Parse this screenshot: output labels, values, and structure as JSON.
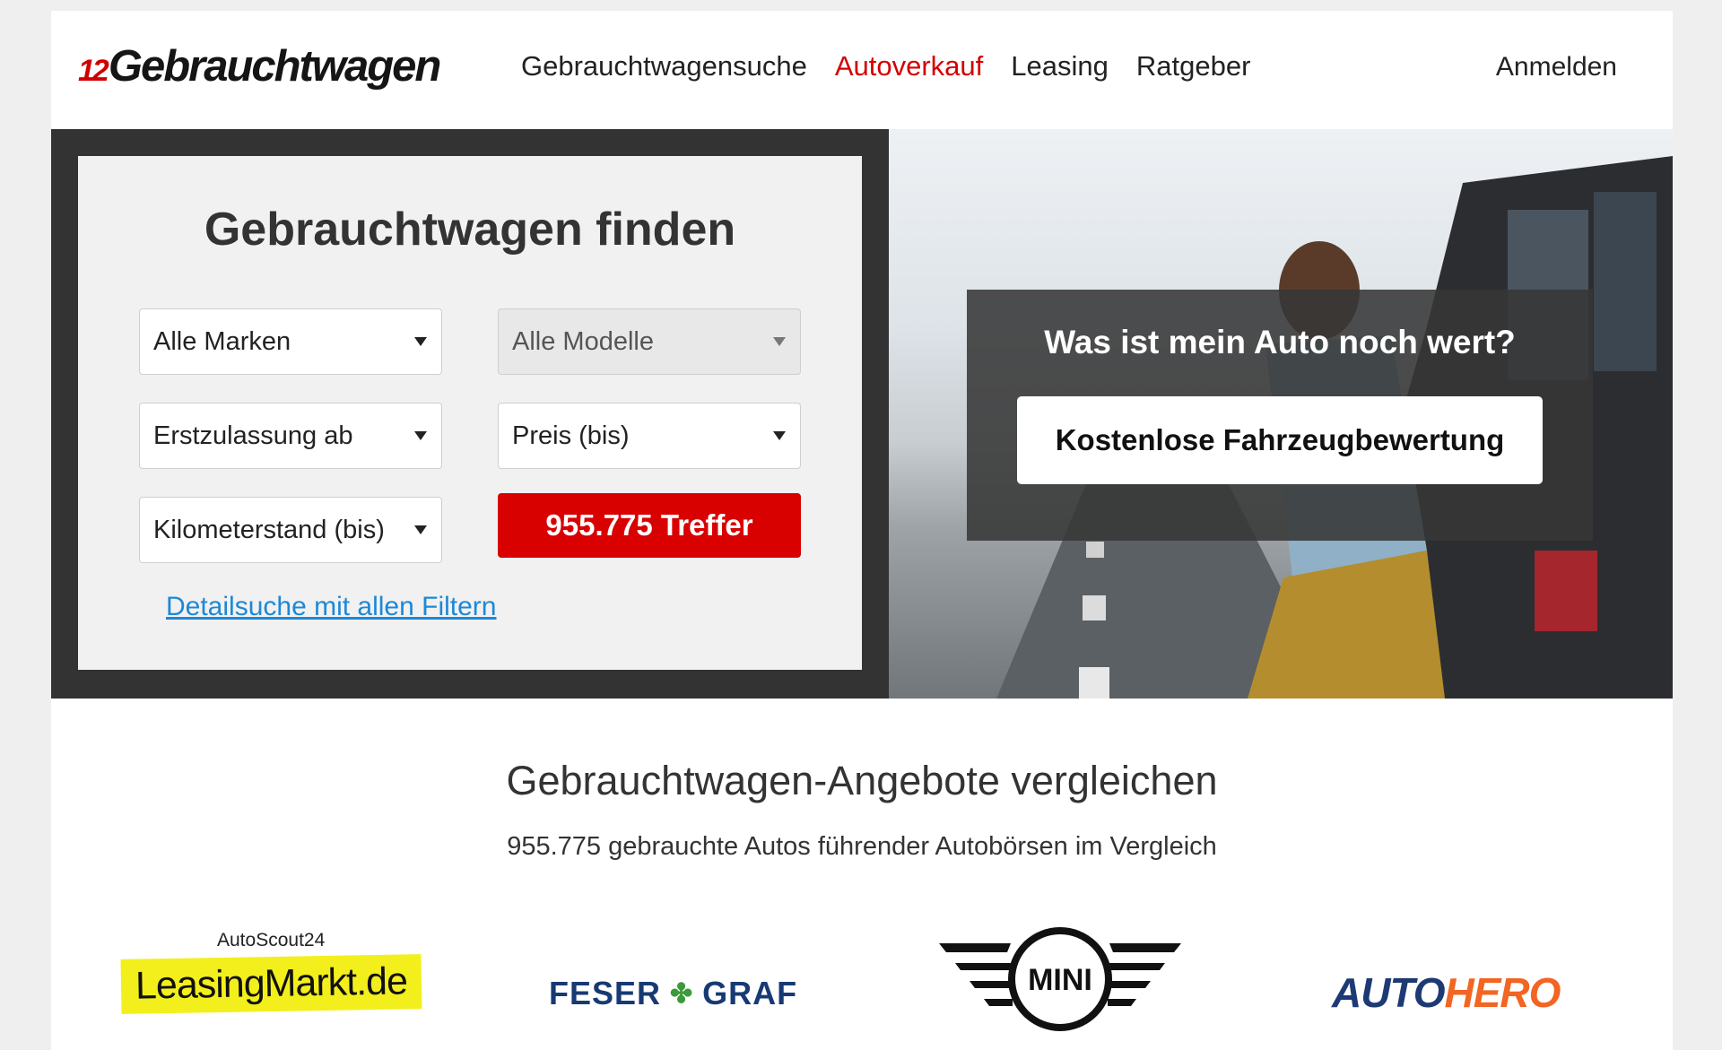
{
  "header": {
    "logo_number": "12",
    "logo_word": "Gebrauchtwagen",
    "nav": [
      {
        "label": "Gebrauchtwagensuche",
        "active": false
      },
      {
        "label": "Autoverkauf",
        "active": true
      },
      {
        "label": "Leasing",
        "active": false
      },
      {
        "label": "Ratgeber",
        "active": false
      }
    ],
    "login_label": "Anmelden"
  },
  "search": {
    "title": "Gebrauchtwagen finden",
    "make": "Alle Marken",
    "model": "Alle Modelle",
    "first_registration": "Erstzulassung ab",
    "price": "Preis (bis)",
    "mileage": "Kilometerstand (bis)",
    "results_button": "955.775 Treffer",
    "detail_link": "Detailsuche mit allen Filtern"
  },
  "valuation": {
    "title": "Was ist mein Auto noch wert?",
    "button": "Kostenlose Fahrzeugbewertung"
  },
  "compare": {
    "title": "Gebrauchtwagen-Angebote vergleichen",
    "subtitle": "955.775 gebrauchte Autos führender Autobörsen im Vergleich"
  },
  "partners": {
    "leasingmarkt_top": "AutoScout24",
    "leasingmarkt_main": "LeasingMarkt.de",
    "feser_a": "FESER",
    "feser_b": "GRAF",
    "mini": "MINI",
    "autohero_a": "AUTO",
    "autohero_b": "HERO"
  },
  "colors": {
    "accent_red": "#d90000",
    "link_blue": "#1e88d6",
    "dark_panel": "#333333"
  }
}
